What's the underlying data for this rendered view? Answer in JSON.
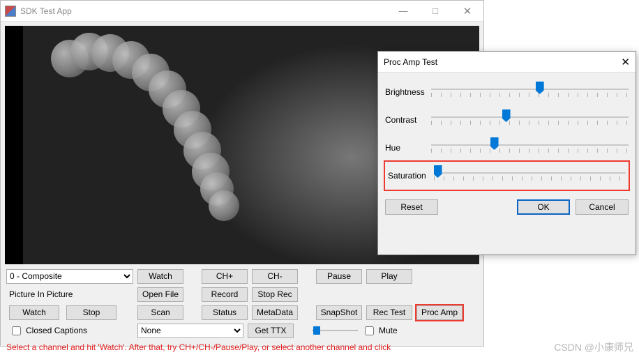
{
  "main": {
    "title": "SDK Test App",
    "source_select": "0 - Composite",
    "pip_label": "Picture In Picture",
    "closed_captions": "Closed Captions",
    "caption_select": "None",
    "mute": "Mute",
    "status": "Select a channel and hit 'Watch'. After that, try CH+/CH-/Pause/Play, or select another channel and click",
    "buttons": {
      "watch": "Watch",
      "ch_plus": "CH+",
      "ch_minus": "CH-",
      "pause": "Pause",
      "play": "Play",
      "open_file": "Open File",
      "record": "Record",
      "stop_rec": "Stop Rec",
      "watch2": "Watch",
      "stop": "Stop",
      "scan": "Scan",
      "status_btn": "Status",
      "metadata": "MetaData",
      "snapshot": "SnapShot",
      "rec_test": "Rec Test",
      "proc_amp": "Proc Amp",
      "get_ttx": "Get TTX"
    }
  },
  "dialog": {
    "title": "Proc Amp Test",
    "sliders": {
      "brightness": {
        "label": "Brightness",
        "pos": 55
      },
      "contrast": {
        "label": "Contrast",
        "pos": 38
      },
      "hue": {
        "label": "Hue",
        "pos": 32
      },
      "saturation": {
        "label": "Saturation",
        "pos": 2
      }
    },
    "buttons": {
      "reset": "Reset",
      "ok": "OK",
      "cancel": "Cancel"
    }
  },
  "watermark": "CSDN @小康师兄"
}
